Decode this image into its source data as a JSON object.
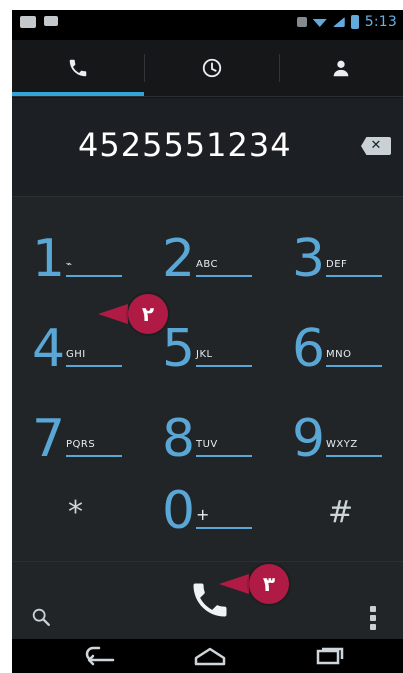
{
  "statusbar": {
    "time": "5:13",
    "icons": [
      "mail-icon",
      "gallery-icon",
      "mute-icon",
      "wifi-icon",
      "signal-icon",
      "battery-icon"
    ]
  },
  "tabs": {
    "items": [
      {
        "name": "phone",
        "icon": "phone-icon",
        "selected": true
      },
      {
        "name": "call-log",
        "icon": "clock-icon",
        "selected": false
      },
      {
        "name": "contacts",
        "icon": "person-icon",
        "selected": false
      }
    ]
  },
  "display": {
    "number": "4525551234",
    "backspace_icon": "backspace-icon"
  },
  "keypad": {
    "keys": [
      {
        "digit": "1",
        "letters": "⌁"
      },
      {
        "digit": "2",
        "letters": "ABC"
      },
      {
        "digit": "3",
        "letters": "DEF"
      },
      {
        "digit": "4",
        "letters": "GHI"
      },
      {
        "digit": "5",
        "letters": "JKL"
      },
      {
        "digit": "6",
        "letters": "MNO"
      },
      {
        "digit": "7",
        "letters": "PQRS"
      },
      {
        "digit": "8",
        "letters": "TUV"
      },
      {
        "digit": "9",
        "letters": "WXYZ"
      },
      {
        "digit": "*",
        "letters": ""
      },
      {
        "digit": "0",
        "letters": "+"
      },
      {
        "digit": "#",
        "letters": ""
      }
    ]
  },
  "bottom": {
    "left_icon": "search-icon",
    "center_icon": "phone-call-icon",
    "right_icon": "overflow-menu-icon"
  },
  "callouts": {
    "two": "٢",
    "three": "٣"
  },
  "navbar": {
    "icons": [
      "back-icon",
      "home-icon",
      "recent-apps-icon"
    ]
  },
  "colors": {
    "accent": "#5aa7d6",
    "badge": "#b01b45"
  }
}
